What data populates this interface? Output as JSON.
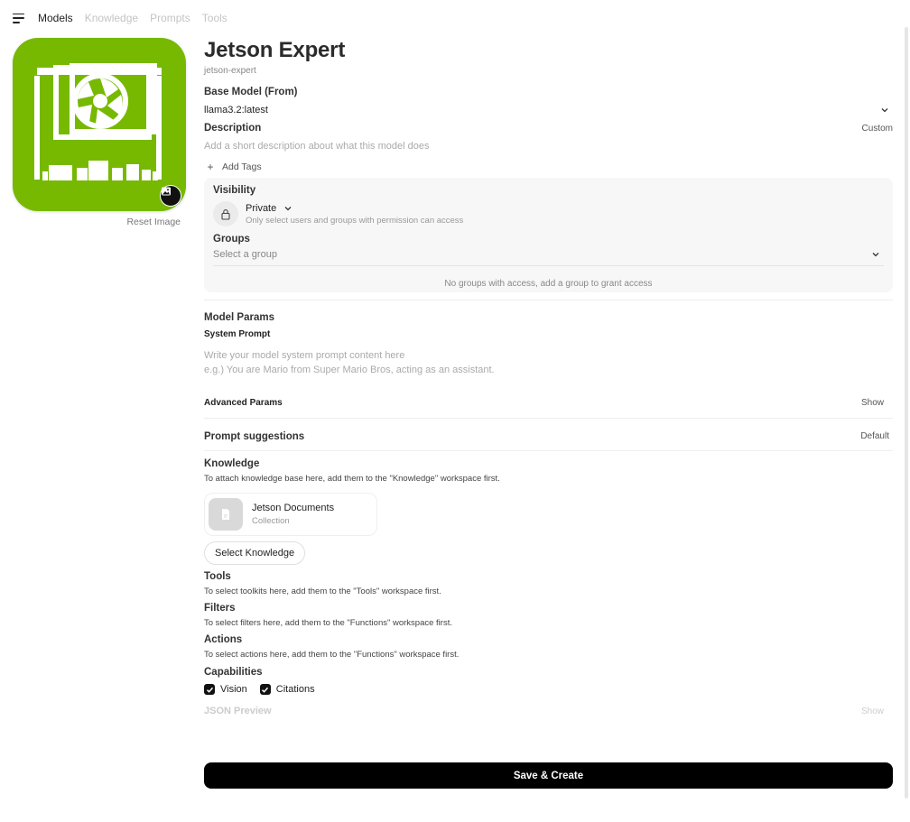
{
  "nav": {
    "tabs": [
      {
        "label": "Models",
        "active": true
      },
      {
        "label": "Knowledge",
        "active": false
      },
      {
        "label": "Prompts",
        "active": false
      },
      {
        "label": "Tools",
        "active": false
      }
    ]
  },
  "image": {
    "icon": "gpu-board-logo",
    "background_color": "#76b900",
    "upload_icon": "image-icon",
    "reset_label": "Reset Image"
  },
  "model": {
    "name": "Jetson Expert",
    "id": "jetson-expert"
  },
  "base_model": {
    "label": "Base Model (From)",
    "value": "llama3.2:latest"
  },
  "description": {
    "label": "Description",
    "toggle": "Custom",
    "placeholder": "Add a short description about what this model does"
  },
  "tags": {
    "add_label": "Add Tags"
  },
  "access": {
    "visibility_label": "Visibility",
    "visibility_value": "Private",
    "visibility_help": "Only select users and groups with permission can access",
    "groups_label": "Groups",
    "groups_placeholder": "Select a group",
    "no_groups": "No groups with access, add a group to grant access"
  },
  "params": {
    "label": "Model Params",
    "system_prompt_label": "System Prompt",
    "system_prompt_placeholder_line1": "Write your model system prompt content here",
    "system_prompt_placeholder_line2": "e.g.) You are Mario from Super Mario Bros, acting as an assistant.",
    "advanced_label": "Advanced Params",
    "advanced_toggle": "Show"
  },
  "prompt_suggestions": {
    "label": "Prompt suggestions",
    "toggle": "Default"
  },
  "knowledge": {
    "label": "Knowledge",
    "help": "To attach knowledge base here, add them to the \"Knowledge\" workspace first.",
    "items": [
      {
        "name": "Jetson Documents",
        "type": "Collection"
      }
    ],
    "select_button": "Select Knowledge"
  },
  "tools": {
    "label": "Tools",
    "help": "To select toolkits here, add them to the \"Tools\" workspace first."
  },
  "filters": {
    "label": "Filters",
    "help": "To select filters here, add them to the \"Functions\" workspace first."
  },
  "actions": {
    "label": "Actions",
    "help": "To select actions here, add them to the \"Functions\" workspace first."
  },
  "capabilities": {
    "label": "Capabilities",
    "items": [
      {
        "label": "Vision",
        "checked": true
      },
      {
        "label": "Citations",
        "checked": true
      }
    ]
  },
  "json_preview": {
    "label": "JSON Preview",
    "toggle": "Show"
  },
  "save_button": "Save & Create"
}
